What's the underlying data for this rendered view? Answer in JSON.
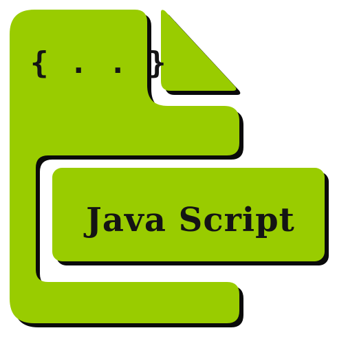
{
  "icon": {
    "name": "javascript-file-icon",
    "braces": "{ . . }",
    "label": "Java Script",
    "colors": {
      "fill": "#99cc00",
      "shadow": "#0a0a0a",
      "text": "#141414",
      "background": "#ffffff"
    }
  }
}
